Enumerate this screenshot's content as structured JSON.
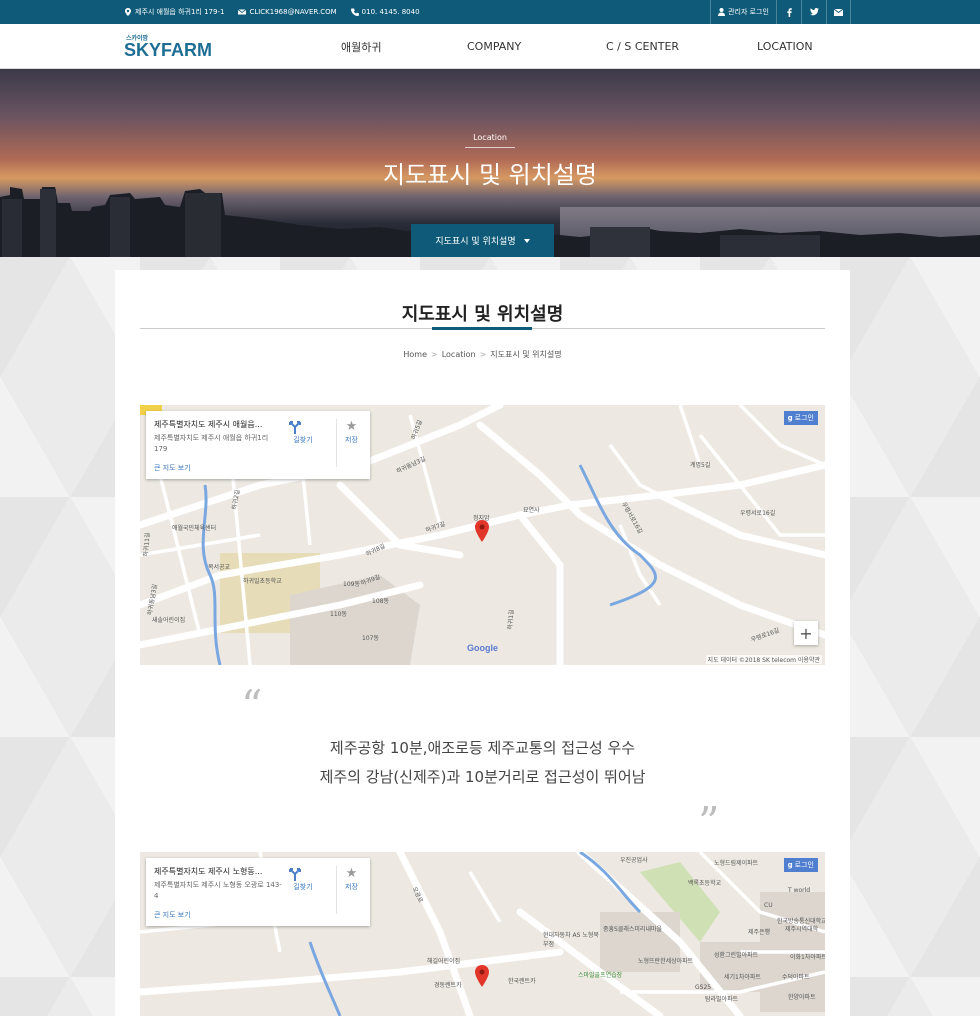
{
  "topbar": {
    "address": "제주시 애월읍 하귀1리 179-1",
    "email": "CLICK1968@NAVER.COM",
    "phone": "010. 4145. 8040",
    "admin_login": "관리자 로그인"
  },
  "nav": {
    "logo_small": "스카이팜",
    "logo_big": "SKYFARM",
    "menu": [
      "애월하귀",
      "COMPANY",
      "C / S CENTER",
      "LOCATION"
    ]
  },
  "hero": {
    "label": "Location",
    "title": "지도표시 및 위치설명",
    "dropdown": "지도표시 및 위치설명"
  },
  "content": {
    "heading": "지도표시 및 위치설명",
    "breadcrumb": [
      "Home",
      "Location",
      "지도표시 및 위치설명"
    ],
    "breadcrumb_sep": ">"
  },
  "map1": {
    "card_title": "제주특별자치도 제주시 애월읍...",
    "card_address": "제주특별자치도 제주시 애월읍 하귀1리 179",
    "card_big_map": "큰 지도 보기",
    "directions": "길찾기",
    "save": "저장",
    "login": "로그인",
    "login_badge": "g",
    "google": "Google",
    "attribution": "지도 데이터 ©2018 SK telecom   이용약관",
    "labels": {
      "l1": "하귀5길",
      "l2": "하귀동남3길",
      "l3": "계명5길",
      "l4": "우령서로16길",
      "l5": "우령서로16길",
      "l6": "묘연사",
      "l7": "정지암",
      "l8": "하귀7길",
      "l9": "하귀9길",
      "l10": "하귀8길",
      "l11": "109동",
      "l12": "108동",
      "l13": "110동",
      "l14": "107동",
      "l15": "애월국민체육센터",
      "l16": "목서공교",
      "l17": "하귀일초등학교",
      "l18": "새솔어린이집",
      "l19": "하귀1길",
      "l20": "우령로16길",
      "l21": "하귀11길",
      "l22": "하귀동남3길",
      "l23": "하귀2길"
    }
  },
  "quote": {
    "open": "“",
    "close": "”",
    "line1": "제주공항 10분,애조로등 제주교통의 접근성 우수",
    "line2": "제주의 강남(신제주)과 10분거리로 접근성이 뛰어남"
  },
  "map2": {
    "card_title": "제주특별자치도 제주시 노형동...",
    "card_address": "제주특별자치도 제주시 노형동 오광로 143-4",
    "card_big_map": "큰 지도 보기",
    "directions": "길찾기",
    "save": "저장",
    "login": "로그인",
    "login_badge": "g",
    "labels": {
      "l1": "우진공업사",
      "l2": "노형드림제이파트",
      "l3": "백록초등학교",
      "l4": "T world",
      "l5": "한국방송통신대학교",
      "l6": "제주시역대학",
      "l7": "제주은행",
      "l8": "현대자동차 AS 노형북부점",
      "l9": "중흥S클래스미리내마을",
      "l10": "노형뜨란한세상아파트",
      "l11": "성환그린빌아파트",
      "l12": "이화1차아파트",
      "l13": "세기1차아파트",
      "l14": "수덕아파트",
      "l15": "한양아파트",
      "l16": "해길어린이집",
      "l17": "경동렌트카",
      "l18": "한국렌트카",
      "l19": "스마일골프연습장",
      "l20": "GS25",
      "l21": "탐라빌아파트",
      "l22": "오광로",
      "l23": "CU"
    }
  },
  "colors": {
    "primary": "#0e5a78",
    "map_bg": "#ede9e2",
    "pin": "#e2362a"
  }
}
